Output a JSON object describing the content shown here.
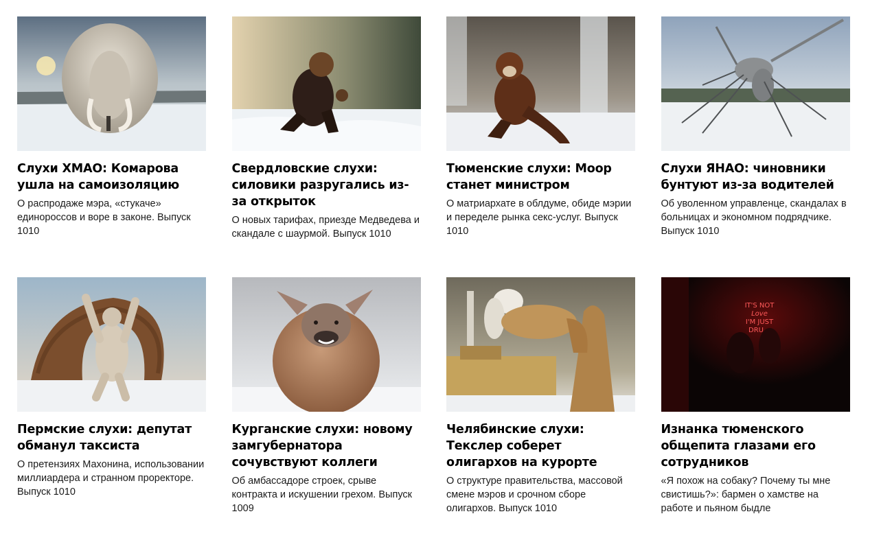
{
  "articles": [
    {
      "title": "Слухи ХМАО: Комарова ушла на самоизоляцию",
      "desc": "О распродаже мэра, «стукаче» единороссов и воре в законе. Выпуск 1010",
      "image": "woolly-mammoth-in-snow"
    },
    {
      "title": "Свердловские слухи: силовики разругались из-за открыток",
      "desc": "О новых тарифах, приезде Медведева и скандале с шаурмой. Выпуск 1010",
      "image": "bear-in-coat-fighting-stance"
    },
    {
      "title": "Тюменские слухи: Моор станет министром",
      "desc": "О матриархате в облдуме, обиде мэрии и переделе рынка секс-услуг. Выпуск 1010",
      "image": "sable-in-kung-fu-pose"
    },
    {
      "title": "Слухи ЯНАО: чиновники бунтуют из-за водителей",
      "desc": "Об уволенном управленце, скандалах в больницах и экономном подрядчике. Выпуск 1010",
      "image": "giant-metal-mosquito"
    },
    {
      "title": "Пермские слухи: депутат обманул таксиста",
      "desc": "О претензиях Махонина, использовании миллиардера и странном проректоре. Выпуск 1010",
      "image": "polar-bear-with-log-pile"
    },
    {
      "title": "Курганские слухи: новому замгубернатора сочувствуют коллеги",
      "desc": "Об амбассадоре строек, срыве контракта и искушении грехом. Выпуск 1009",
      "image": "round-furry-deer"
    },
    {
      "title": "Челябинские слухи: Текслер соберет олигархов на курорте",
      "desc": "О структуре правительства, массовой смене мэров и срочном сборе олигархов. Выпуск 1010",
      "image": "camel-near-factory"
    },
    {
      "title": "Изнанка тюменского общепита глазами его сотрудников",
      "desc": "«Я похож на собаку? Почему ты мне свистишь?»: бармен о хамстве на работе и пьяном быдле",
      "image": "neon-sign-dark-bar",
      "neon_text": [
        "IT'S NOT",
        "Love",
        "I'M JUST",
        "DRU"
      ]
    }
  ],
  "colors": {
    "text": "#000000",
    "desc": "#1a1a1a",
    "neon": "#ff3b3b"
  }
}
